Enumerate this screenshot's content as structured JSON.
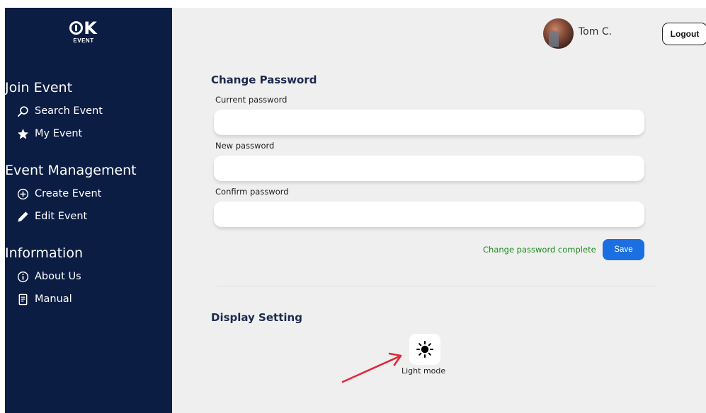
{
  "brand": {
    "logo_mark": "K",
    "logo_sub": "EVENT"
  },
  "sidebar": {
    "sections": [
      {
        "title": "Join Event",
        "items": [
          {
            "label": "Search Event",
            "icon": "search-icon"
          },
          {
            "label": "My Event",
            "icon": "star-icon"
          }
        ]
      },
      {
        "title": "Event Management",
        "items": [
          {
            "label": "Create Event",
            "icon": "plus-circle-icon"
          },
          {
            "label": "Edit Event",
            "icon": "pencil-icon"
          }
        ]
      },
      {
        "title": "Information",
        "items": [
          {
            "label": "About Us",
            "icon": "info-icon"
          },
          {
            "label": "Manual",
            "icon": "document-icon"
          }
        ]
      }
    ]
  },
  "header": {
    "user_name": "Tom C.",
    "logout_label": "Logout"
  },
  "change_password": {
    "title": "Change Password",
    "current_label": "Current password",
    "current_value": "",
    "new_label": "New password",
    "new_value": "",
    "confirm_label": "Confirm password",
    "confirm_value": "",
    "status": "Change password complete",
    "save_label": "Save"
  },
  "display_setting": {
    "title": "Display Setting",
    "mode_label": "Light mode",
    "mode_icon": "sun-icon"
  },
  "colors": {
    "sidebar_bg": "#0c1d44",
    "page_bg": "#efefef",
    "accent": "#1b6fe0",
    "success": "#1f8a1f",
    "annotation_arrow": "#e0283a"
  }
}
